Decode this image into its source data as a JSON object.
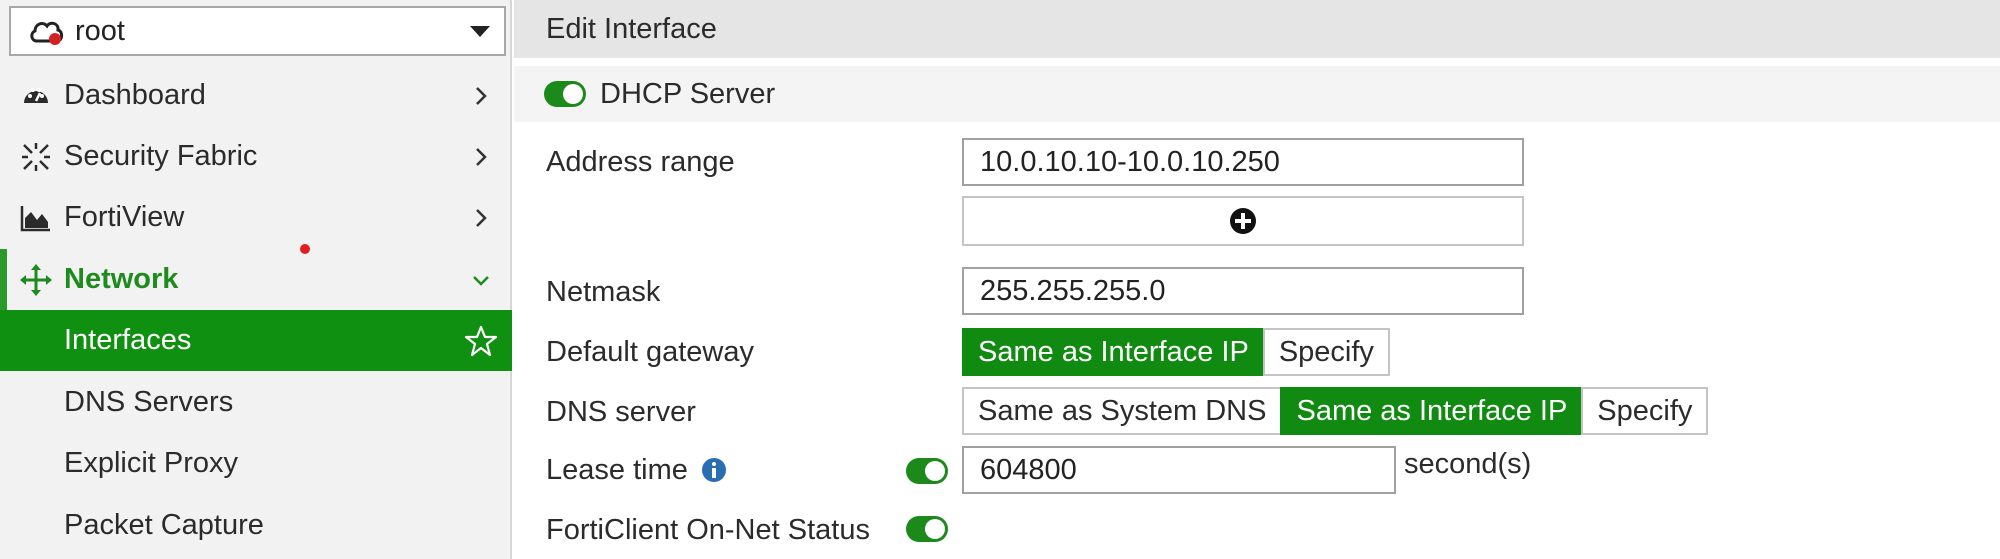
{
  "sidebar": {
    "vdom": {
      "label": "root",
      "icon": "cloud-alert-icon"
    },
    "items": [
      {
        "label": "Dashboard",
        "icon": "dashboard-gauge-icon"
      },
      {
        "label": "Security Fabric",
        "icon": "security-fabric-icon"
      },
      {
        "label": "FortiView",
        "icon": "area-chart-icon"
      },
      {
        "label": "Network",
        "icon": "move-arrows-icon"
      }
    ],
    "network_sub": [
      {
        "label": "Interfaces"
      },
      {
        "label": "DNS Servers"
      },
      {
        "label": "Explicit Proxy"
      },
      {
        "label": "Packet Capture"
      }
    ]
  },
  "page": {
    "title": "Edit Interface",
    "section_title": "DHCP Server"
  },
  "form": {
    "address_range": {
      "label": "Address range",
      "value": "10.0.10.10-10.0.10.250"
    },
    "netmask": {
      "label": "Netmask",
      "value": "255.255.255.0"
    },
    "default_gateway": {
      "label": "Default gateway",
      "options": [
        "Same as Interface IP",
        "Specify"
      ],
      "selected": "Same as Interface IP"
    },
    "dns_server": {
      "label": "DNS server",
      "options": [
        "Same as System DNS",
        "Same as Interface IP",
        "Specify"
      ],
      "selected": "Same as Interface IP"
    },
    "lease_time": {
      "label": "Lease time",
      "value": "604800",
      "unit": "second(s)"
    },
    "forticlient": {
      "label": "FortiClient On-Net Status"
    }
  },
  "colors": {
    "accent_green": "#109010",
    "toggle_green": "#1b8a1b",
    "network_green": "#1e8b1e",
    "info_blue": "#2a6db0",
    "dot_red": "#e02020"
  }
}
